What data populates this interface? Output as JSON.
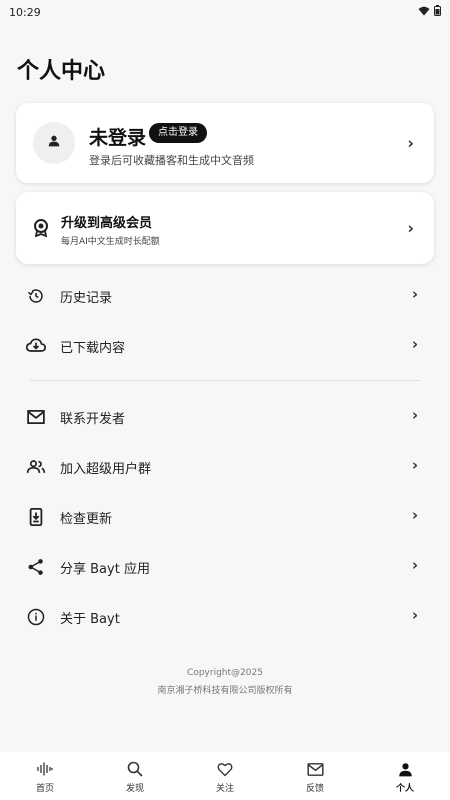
{
  "status_bar": {
    "time": "10:29"
  },
  "page": {
    "title": "个人中心"
  },
  "login_card": {
    "title": "未登录",
    "badge": "点击登录",
    "subtitle": "登录后可收藏播客和生成中文音频"
  },
  "premium_card": {
    "title": "升级到高级会员",
    "subtitle": "每月AI中文生成时长配额"
  },
  "menu_group_1": [
    {
      "label": "历史记录",
      "icon": "history-icon"
    },
    {
      "label": "已下载内容",
      "icon": "cloud-download-icon"
    }
  ],
  "menu_group_2": [
    {
      "label": "联系开发者",
      "icon": "mail-icon"
    },
    {
      "label": "加入超级用户群",
      "icon": "group-icon"
    },
    {
      "label": "检查更新",
      "icon": "system-update-icon"
    },
    {
      "label": "分享 Bayt 应用",
      "icon": "share-icon"
    },
    {
      "label": "关于 Bayt",
      "icon": "info-icon"
    }
  ],
  "footer": {
    "copyright_line1": "Copyright@2025",
    "copyright_line2": "南京湘子桥科技有限公司版权所有"
  },
  "bottom_nav": [
    {
      "label": "首页",
      "icon": "waveform-icon"
    },
    {
      "label": "发现",
      "icon": "search-icon"
    },
    {
      "label": "关注",
      "icon": "heart-icon"
    },
    {
      "label": "反馈",
      "icon": "mail-icon"
    },
    {
      "label": "个人",
      "icon": "person-icon",
      "active": true
    }
  ]
}
